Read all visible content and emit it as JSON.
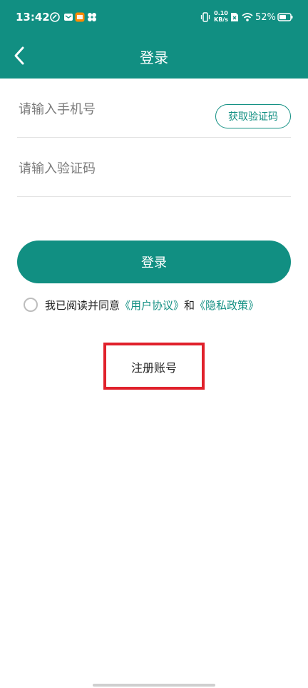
{
  "status_bar": {
    "time": "13:42",
    "network_speed_top": "0.10",
    "network_speed_bottom": "KB/s",
    "battery_percent": "52%"
  },
  "header": {
    "title": "登录"
  },
  "form": {
    "phone_placeholder": "请输入手机号",
    "get_code_label": "获取验证码",
    "code_placeholder": "请输入验证码",
    "login_label": "登录",
    "agreement_prefix": "我已阅读并同意",
    "user_agreement": "《用户协议》",
    "and_text": "和",
    "privacy_policy": "《隐私政策》",
    "register_label": "注册账号"
  },
  "colors": {
    "primary": "#118f82",
    "highlight_box": "#e0212b"
  }
}
